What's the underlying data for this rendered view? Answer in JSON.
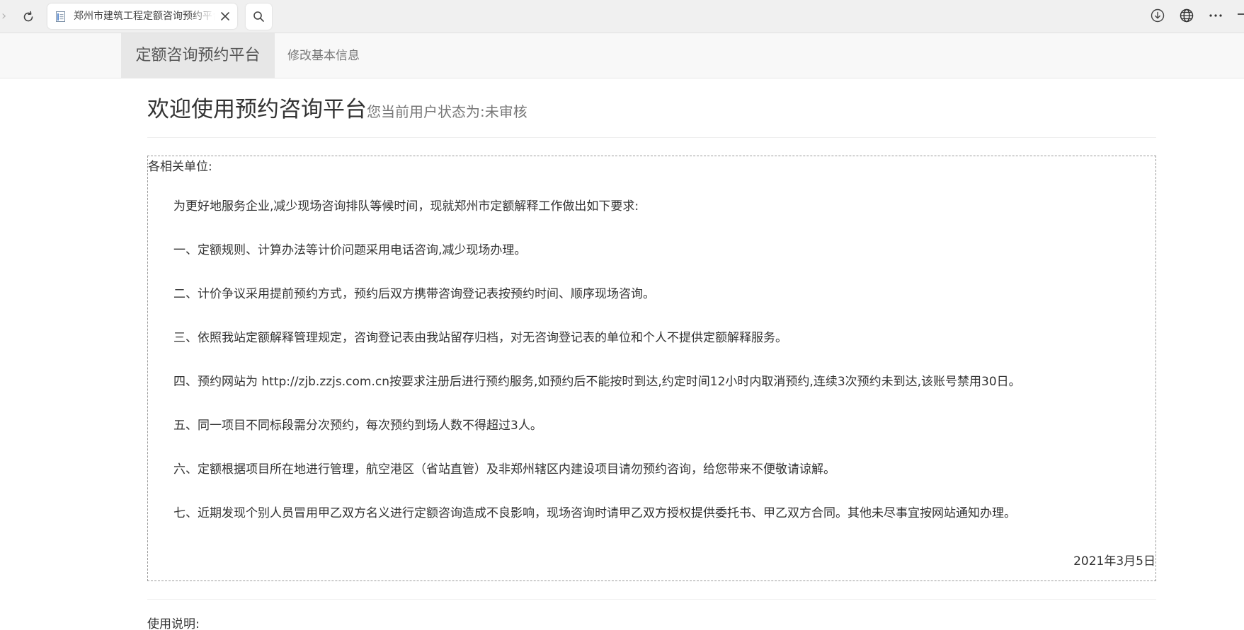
{
  "browser": {
    "tab_title": "郑州市建筑工程定额咨询预约平台"
  },
  "site": {
    "brand": "定额咨询预约平台",
    "nav": [
      {
        "label": "修改基本信息"
      }
    ]
  },
  "page": {
    "title": "欢迎使用预约咨询平台",
    "status_prefix": "您当前用户状态为:",
    "status_value": "未审核"
  },
  "notice": {
    "addressee": "各相关单位:",
    "intro": "为更好地服务企业,减少现场咨询排队等候时间，现就郑州市定额解释工作做出如下要求:",
    "items": [
      "一、定额规则、计算办法等计价问题采用电话咨询,减少现场办理。",
      "二、计价争议采用提前预约方式，预约后双方携带咨询登记表按预约时间、顺序现场咨询。",
      "三、依照我站定额解释管理规定，咨询登记表由我站留存归档，对无咨询登记表的单位和个人不提供定额解释服务。",
      "四、预约网站为 http://zjb.zzjs.com.cn按要求注册后进行预约服务,如预约后不能按时到达,约定时间12小时内取消预约,连续3次预约未到达,该账号禁用30日。",
      "五、同一项目不同标段需分次预约，每次预约到场人数不得超过3人。",
      "六、定额根据项目所在地进行管理，航空港区（省站直管）及非郑州辖区内建设项目请勿预约咨询，给您带来不便敬请谅解。",
      "七、近期发现个别人员冒用甲乙双方名义进行定额咨询造成不良影响，现场咨询时请甲乙双方授权提供委托书、甲乙双方合同。其他未尽事宜按网站通知办理。"
    ],
    "date": "2021年3月5日"
  },
  "usage": {
    "title": "使用说明:"
  }
}
